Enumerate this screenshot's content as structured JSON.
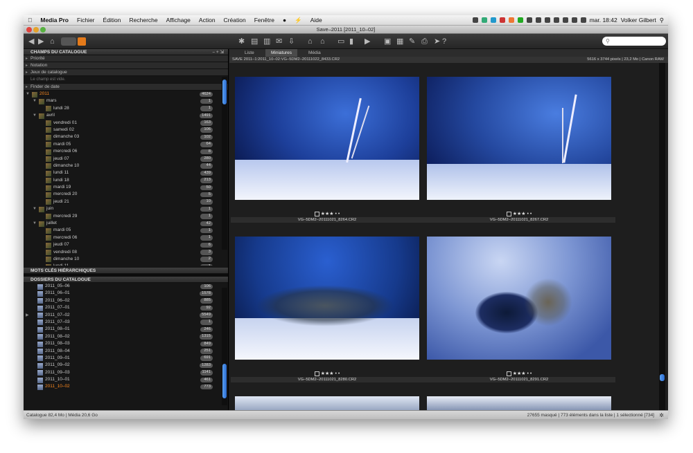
{
  "menubar": {
    "apple": "",
    "app": "Media Pro",
    "items": [
      "Fichier",
      "Édition",
      "Recherche",
      "Affichage",
      "Action",
      "Création",
      "Fenêtre"
    ],
    "help": "Aide",
    "clock": "mar. 18:42",
    "user": "Volker Gilbert"
  },
  "window": {
    "title": "Save–2011 [2011_10–02]"
  },
  "toolbar": {
    "search_placeholder": ""
  },
  "left": {
    "catalog_fields_header": "CHAMPS DU CATALOGUE",
    "sections": [
      "Priorité",
      "Notation",
      "Jeux de catalogue"
    ],
    "empty_text": "Le champ est vide.",
    "date_finder": "Finder de date",
    "dates": [
      {
        "label": "2011",
        "count": "4624",
        "level": 0,
        "tw": "▼",
        "sel": true
      },
      {
        "label": "mars",
        "count": "1",
        "level": 1,
        "tw": "▼"
      },
      {
        "label": "lundi 28",
        "count": "1",
        "level": 2
      },
      {
        "label": "avril",
        "count": "1491",
        "level": 1,
        "tw": "▼"
      },
      {
        "label": "vendredi 01",
        "count": "163",
        "level": 2
      },
      {
        "label": "samedi 02",
        "count": "106",
        "level": 2
      },
      {
        "label": "dimanche 03",
        "count": "102",
        "level": 2
      },
      {
        "label": "mardi 05",
        "count": "64",
        "level": 2
      },
      {
        "label": "mercredi 06",
        "count": "8",
        "level": 2
      },
      {
        "label": "jeudi 07",
        "count": "280",
        "level": 2
      },
      {
        "label": "dimanche 10",
        "count": "44",
        "level": 2
      },
      {
        "label": "lundi 11",
        "count": "439",
        "level": 2
      },
      {
        "label": "lundi 18",
        "count": "213",
        "level": 2
      },
      {
        "label": "mardi 19",
        "count": "50",
        "level": 2
      },
      {
        "label": "mercredi 20",
        "count": "5",
        "level": 2
      },
      {
        "label": "jeudi 21",
        "count": "10",
        "level": 2
      },
      {
        "label": "juin",
        "count": "1",
        "level": 1,
        "tw": "▼"
      },
      {
        "label": "mercredi 29",
        "count": "1",
        "level": 2
      },
      {
        "label": "juillet",
        "count": "42",
        "level": 1,
        "tw": "▼"
      },
      {
        "label": "mardi 05",
        "count": "1",
        "level": 2
      },
      {
        "label": "mercredi 06",
        "count": "1",
        "level": 2
      },
      {
        "label": "jeudi 07",
        "count": "6",
        "level": 2
      },
      {
        "label": "vendredi 08",
        "count": "3",
        "level": 2
      },
      {
        "label": "dimanche 10",
        "count": "2",
        "level": 2
      },
      {
        "label": "lundi 11",
        "count": "1",
        "level": 2
      }
    ],
    "keywords_header": "MOTS CLÉS HIÉRARCHIQUES",
    "folders_header": "DOSSIERS DU CATALOGUE",
    "folders": [
      {
        "label": "2011_05–06",
        "count": "106"
      },
      {
        "label": "2011_06–01",
        "count": "1578"
      },
      {
        "label": "2011_06–02",
        "count": "885"
      },
      {
        "label": "2011_07–01",
        "count": "92"
      },
      {
        "label": "2011_07–02",
        "count": "5549",
        "tw": "▶"
      },
      {
        "label": "2011_07–03",
        "count": "1"
      },
      {
        "label": "2011_08–01",
        "count": "246"
      },
      {
        "label": "2011_08–02",
        "count": "1315"
      },
      {
        "label": "2011_08–03",
        "count": "849"
      },
      {
        "label": "2011_08–04",
        "count": "251"
      },
      {
        "label": "2011_09–01",
        "count": "691"
      },
      {
        "label": "2011_09–02",
        "count": "1283"
      },
      {
        "label": "2011_09–03",
        "count": "1141"
      },
      {
        "label": "2011_10–01",
        "count": "461"
      },
      {
        "label": "2011_10–02",
        "count": "773",
        "sel": true
      }
    ]
  },
  "main": {
    "tabs": [
      "Liste",
      "Miniatures",
      "Média"
    ],
    "active_tab": "Miniatures",
    "path": "SAVE 2011–1:2011_10–02:VG–5DM2–20111022_8433.CR2",
    "meta": "5616 x 3744 pixels  |  23,2 Mo  |  Canon RAW",
    "thumbs": [
      {
        "file": "VG–5DM2–20111021_8264.CR2",
        "stars": "★★★ • •"
      },
      {
        "file": "VG–5DM2–20111021_8267.CR2",
        "stars": "★★★ • •"
      },
      {
        "file": "VG–5DM2–20111021_8280.CR2",
        "stars": "★★★ • •"
      },
      {
        "file": "VG–5DM2–20111021_8291.CR2",
        "stars": "★★★ • •"
      }
    ]
  },
  "status": {
    "left": "Catalogue  82,4 Mo   |   Média 20,6 Go",
    "right": "27655 masqué   |   773 éléments dans la liste   |   1 sélectionné [734]"
  }
}
